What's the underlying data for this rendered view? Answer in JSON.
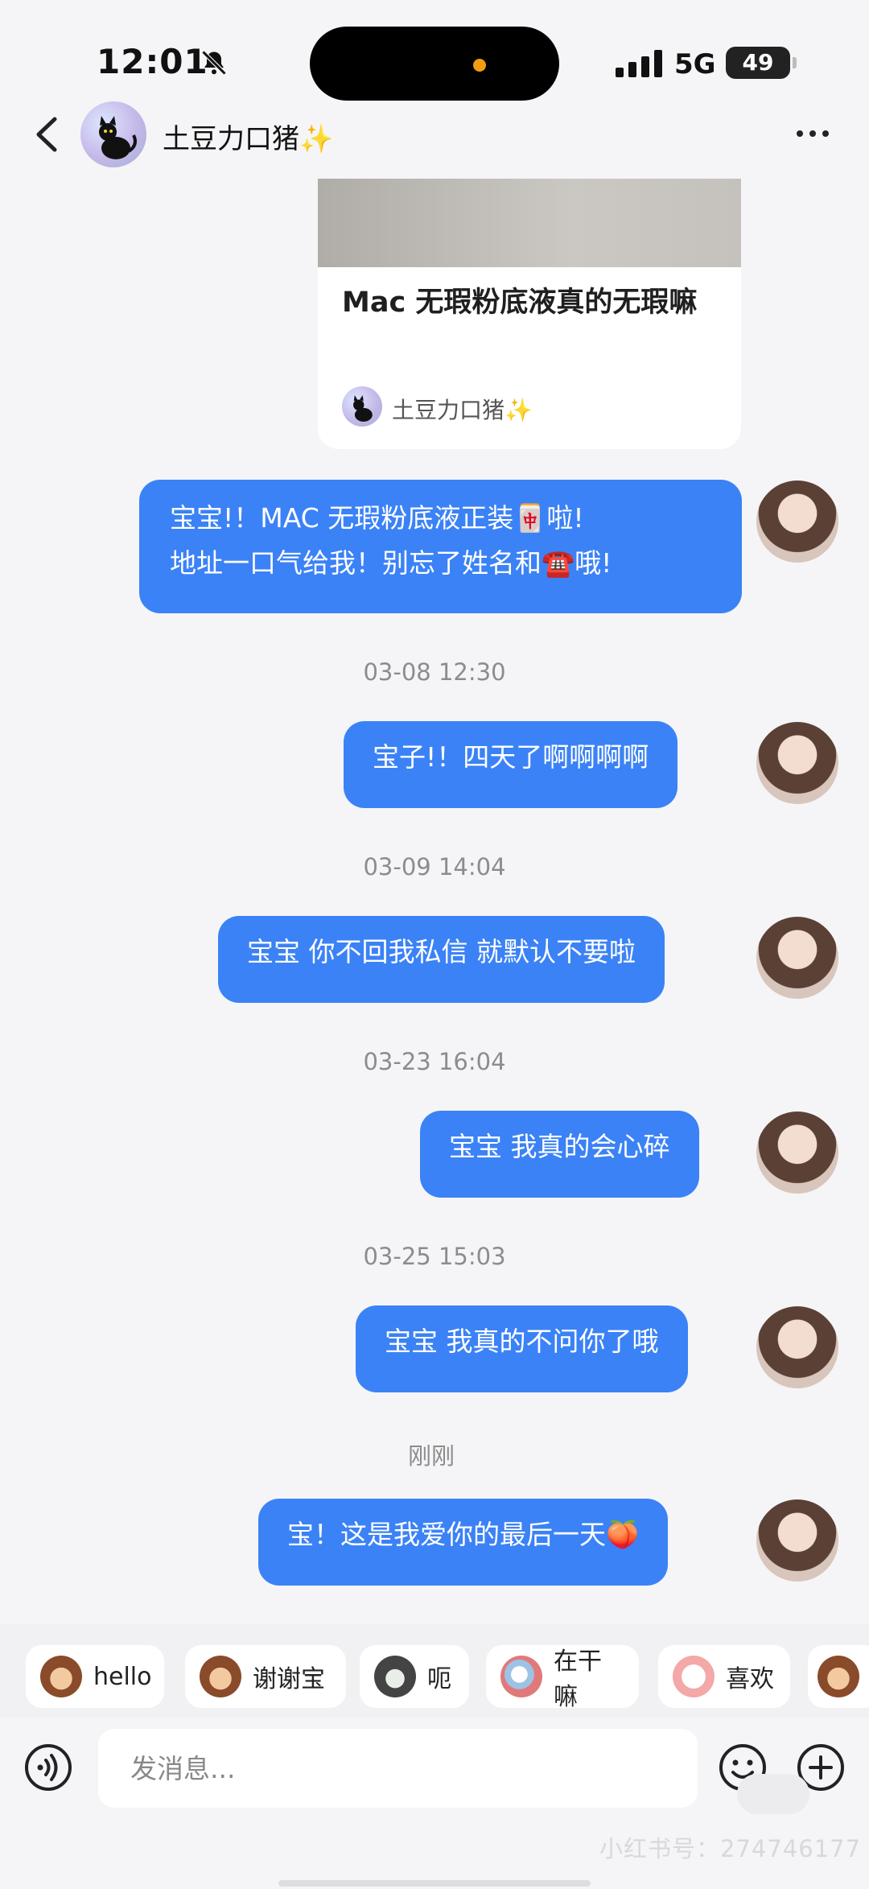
{
  "status_bar": {
    "time": "12:01",
    "network": "5G",
    "battery": "49"
  },
  "header": {
    "contact_name": "土豆力口猪✨"
  },
  "shared_note": {
    "title": "Mac 无瑕粉底液真的无瑕嘛",
    "author": "土豆力口猪✨"
  },
  "messages": [
    {
      "line1": "宝宝!！MAC 无瑕粉底液正装🀄啦!",
      "line2": "地址一口气给我！别忘了姓名和☎️哦!"
    },
    {
      "timestamp": "03-08 12:30",
      "text": "宝子!！四天了啊啊啊啊"
    },
    {
      "timestamp": "03-09 14:04",
      "text": "宝宝 你不回我私信 就默认不要啦"
    },
    {
      "timestamp": "03-23 16:04",
      "text": "宝宝 我真的会心碎"
    },
    {
      "timestamp": "03-25 15:03",
      "text": "宝宝 我真的不问你了哦"
    },
    {
      "timestamp": "刚刚",
      "text": "宝！这是我爱你的最后一天🍑"
    }
  ],
  "quick_replies": [
    {
      "label": "hello",
      "emoji_icon": "monkey-icon"
    },
    {
      "label": "谢谢宝",
      "emoji_icon": "monkey-flower-icon"
    },
    {
      "label": "呃",
      "emoji_icon": "cat-icon"
    },
    {
      "label": "在干嘛",
      "emoji_icon": "peek-icon"
    },
    {
      "label": "喜欢",
      "emoji_icon": "blush-icon"
    }
  ],
  "input": {
    "placeholder": "发消息..."
  },
  "watermark": "小红书号：274746177",
  "colors": {
    "bubble": "#3b82f6",
    "background": "#f5f5f7",
    "accent": "#f39c12"
  }
}
